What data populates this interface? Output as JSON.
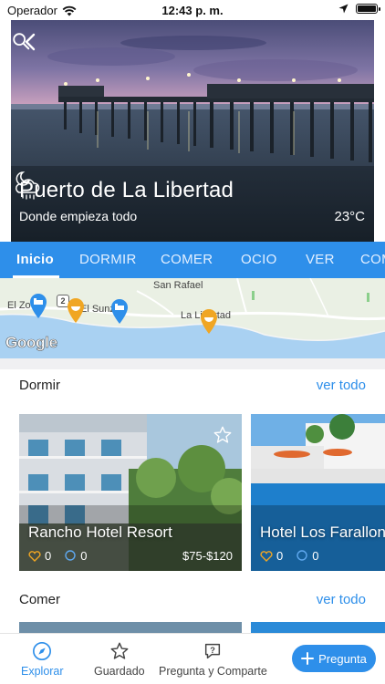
{
  "status_bar": {
    "carrier": "Operador",
    "time": "12:43 p. m."
  },
  "hero": {
    "title": "Puerto de La Libertad",
    "subtitle": "Donde empieza todo",
    "temperature": "23°C",
    "weather_icon": "night-cloud-rain-icon"
  },
  "tabs": [
    {
      "label": "Inicio",
      "active": true
    },
    {
      "label": "DORMIR"
    },
    {
      "label": "COMER"
    },
    {
      "label": "OCIO"
    },
    {
      "label": "VER"
    },
    {
      "label": "COMPRAR"
    }
  ],
  "map": {
    "labels": [
      "San Rafael",
      "La Libertad",
      "El Zo",
      "El Sunz"
    ],
    "road_shield": "2",
    "brand": "Google",
    "markers": [
      "bed-marker-icon",
      "food-marker-icon",
      "bed-marker-icon",
      "food-marker-icon"
    ]
  },
  "sections": {
    "dormir": {
      "title": "Dormir",
      "see_all": "ver todo",
      "cards": [
        {
          "name": "Rancho Hotel Resort",
          "likes": "0",
          "comments": "0",
          "price": "$75-$120"
        },
        {
          "name": "Hotel Los Farallones",
          "likes": "0",
          "comments": "0",
          "price": ""
        }
      ]
    },
    "comer": {
      "title": "Comer",
      "see_all": "ver todo"
    }
  },
  "bottom_nav": {
    "explore": "Explorar",
    "saved": "Guardado",
    "ask_share": "Pregunta y Comparte",
    "ask_button": "Pregunta"
  },
  "colors": {
    "accent": "#2e8fea",
    "marker_bed": "#2e8fea",
    "marker_food": "#f0a623"
  }
}
